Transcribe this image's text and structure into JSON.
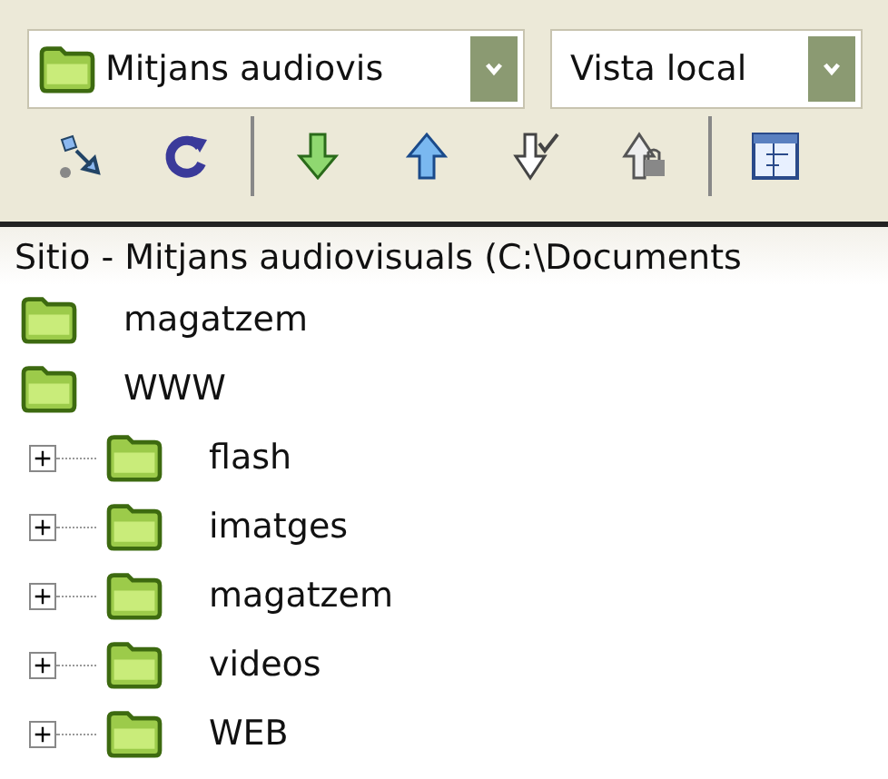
{
  "site_selector": {
    "value": "Mitjans audiovis"
  },
  "view_selector": {
    "value": "Vista local"
  },
  "toolbar": [
    {
      "kind": "connect"
    },
    {
      "kind": "refresh"
    },
    {
      "kind": "separator"
    },
    {
      "kind": "get"
    },
    {
      "kind": "put"
    },
    {
      "kind": "checkout"
    },
    {
      "kind": "checkin"
    },
    {
      "kind": "separator"
    },
    {
      "kind": "expand"
    }
  ],
  "header": "Sitio - Mitjans audiovisuals (C:\\Documents",
  "tree": [
    {
      "label": "magatzem"
    },
    {
      "label": "WWW",
      "children": [
        {
          "label": "flash",
          "expanded": false
        },
        {
          "label": "imatges",
          "expanded": false
        },
        {
          "label": "magatzem",
          "expanded": false
        },
        {
          "label": "videos",
          "expanded": false
        },
        {
          "label": "WEB",
          "expanded": false
        }
      ]
    }
  ]
}
